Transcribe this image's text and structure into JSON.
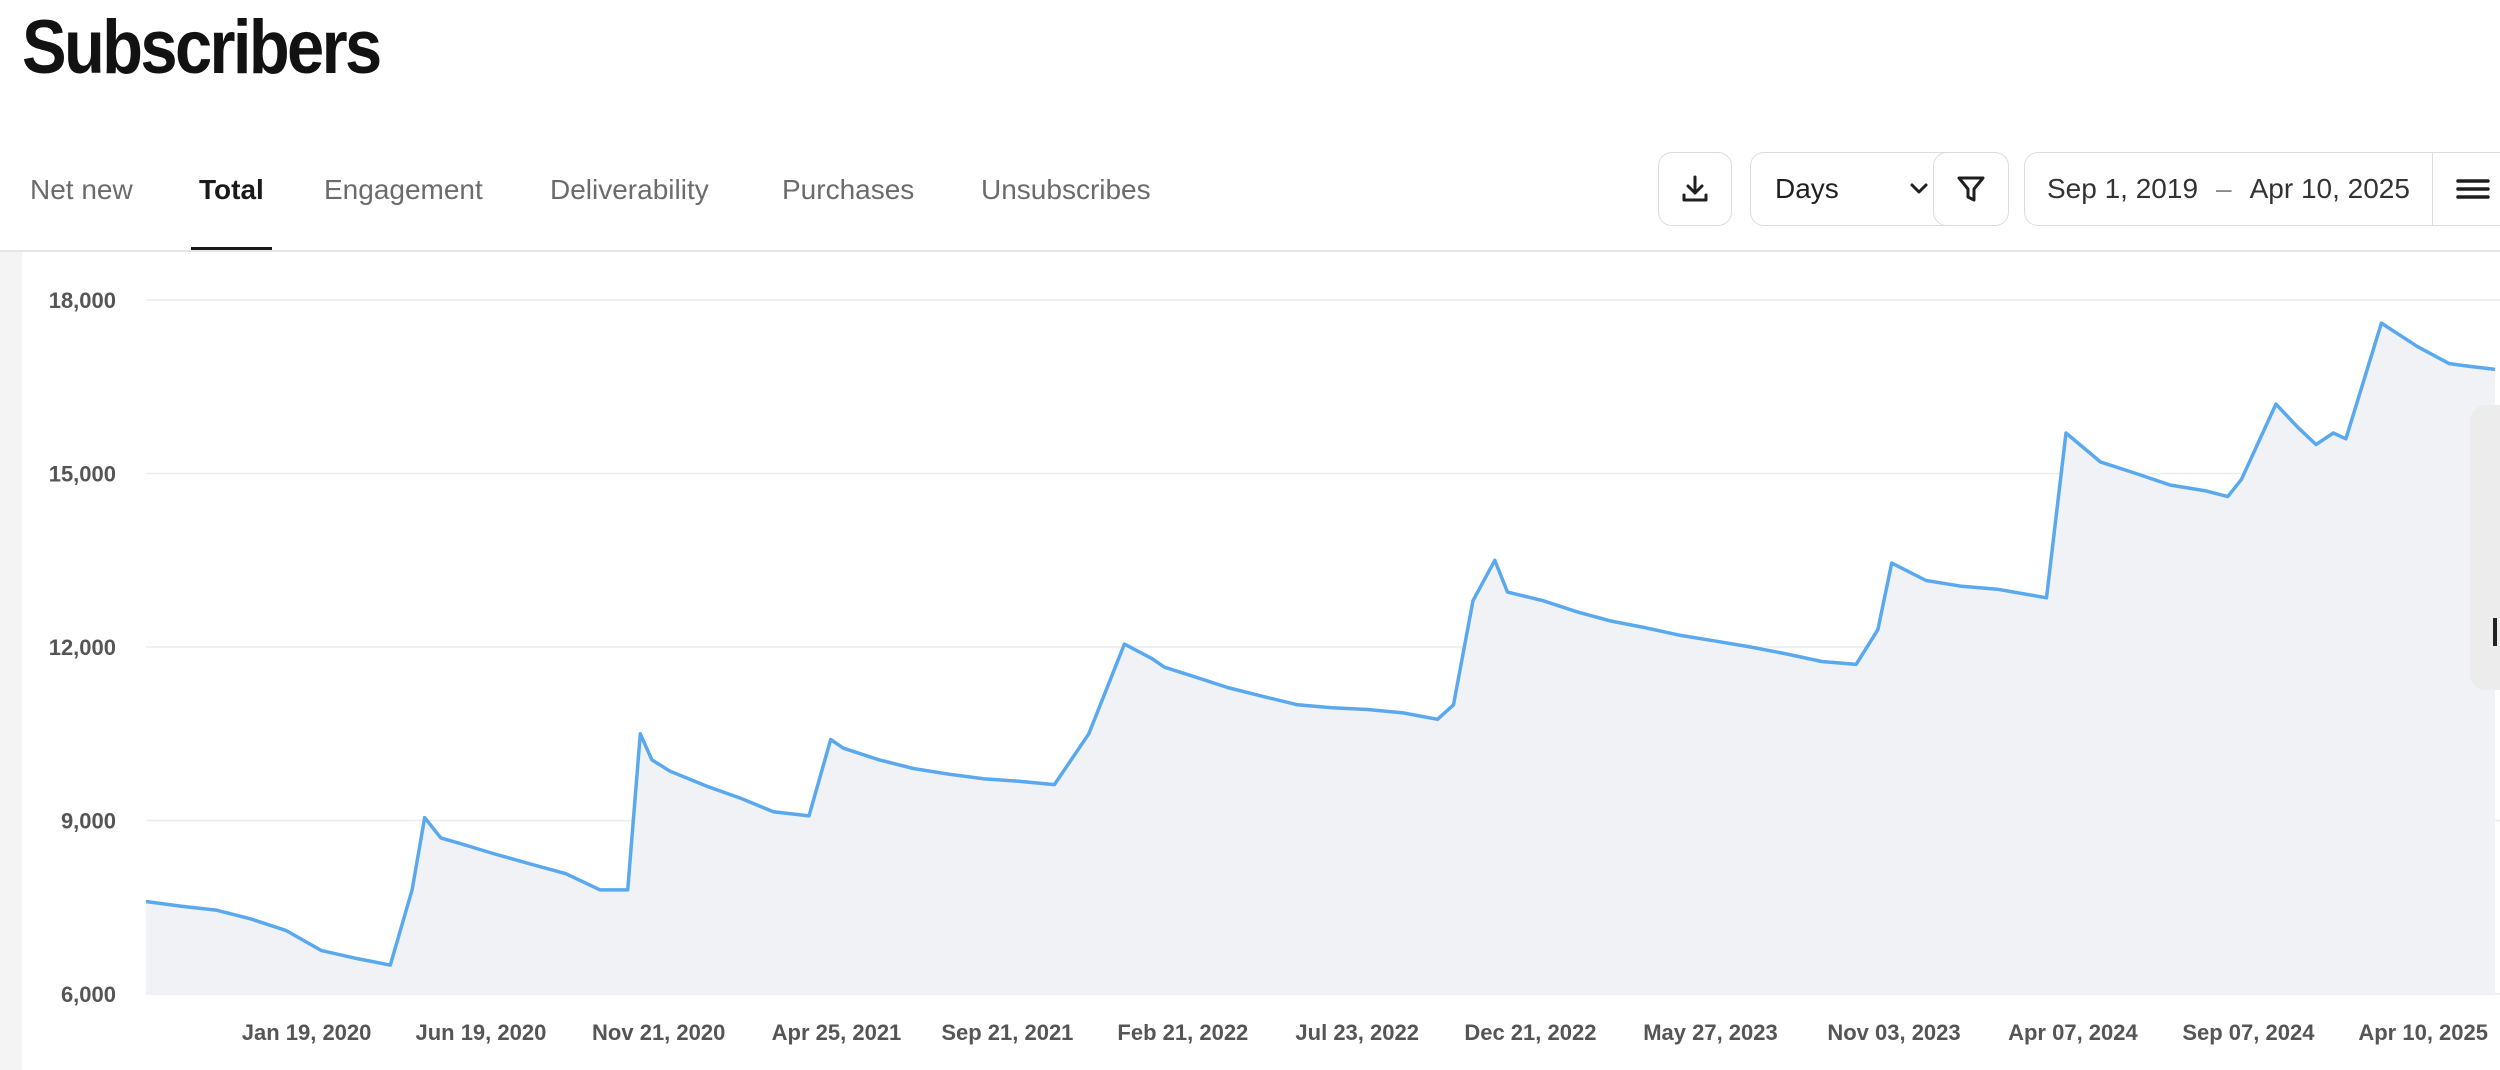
{
  "page": {
    "title": "Subscribers"
  },
  "tabs": [
    {
      "label": "Net new",
      "active": false
    },
    {
      "label": "Total",
      "active": true
    },
    {
      "label": "Engagement",
      "active": false
    },
    {
      "label": "Deliverability",
      "active": false
    },
    {
      "label": "Purchases",
      "active": false
    },
    {
      "label": "Unsubscribes",
      "active": false
    }
  ],
  "toolbar": {
    "download_icon": "download-icon",
    "granularity": "Days",
    "filter_icon": "filter-icon",
    "date_start": "Sep 1, 2019",
    "date_separator": "–",
    "date_end": "Apr 10, 2025",
    "menu_icon": "hamburger-menu-icon"
  },
  "colors": {
    "line": "#5aa9ee",
    "area": "#f1f2f6",
    "grid": "#ececec"
  },
  "chart_data": {
    "type": "area",
    "title": "",
    "xlabel": "",
    "ylabel": "",
    "ylim": [
      6000,
      18000
    ],
    "y_ticks": [
      "6,000",
      "9,000",
      "12,000",
      "15,000",
      "18,000"
    ],
    "y_tick_values": [
      6000,
      9000,
      12000,
      15000,
      18000
    ],
    "x_ticks": [
      "Jan 19, 2020",
      "Jun 19, 2020",
      "Nov 21, 2020",
      "Apr 25, 2021",
      "Sep 21, 2021",
      "Feb 21, 2022",
      "Jul 23, 2022",
      "Dec 21, 2022",
      "May 27, 2023",
      "Nov 03, 2023",
      "Apr 07, 2024",
      "Sep 07, 2024",
      "Apr 10, 2025"
    ],
    "x_tick_dates": [
      "2020-01-19",
      "2020-06-19",
      "2020-11-21",
      "2021-04-25",
      "2021-09-21",
      "2022-02-21",
      "2022-07-23",
      "2022-12-21",
      "2023-05-27",
      "2023-11-03",
      "2024-04-07",
      "2024-09-07",
      "2025-04-10"
    ],
    "grid": true,
    "series": [
      {
        "x": [
          "2019-09-01",
          "2019-10-01",
          "2019-11-01",
          "2019-12-01",
          "2020-01-01",
          "2020-02-01",
          "2020-03-01",
          "2020-04-01",
          "2020-04-20",
          "2020-05-01",
          "2020-05-15",
          "2020-06-01",
          "2020-07-01",
          "2020-08-01",
          "2020-09-01",
          "2020-10-01",
          "2020-10-25",
          "2020-11-05",
          "2020-11-15",
          "2020-12-01",
          "2021-01-01",
          "2021-02-01",
          "2021-03-01",
          "2021-04-01",
          "2021-04-20",
          "2021-05-01",
          "2021-06-01",
          "2021-07-01",
          "2021-08-01",
          "2021-09-01",
          "2021-10-01",
          "2021-11-01",
          "2021-12-01",
          "2022-01-01",
          "2022-01-25",
          "2022-02-05",
          "2022-03-01",
          "2022-04-01",
          "2022-05-01",
          "2022-06-01",
          "2022-07-01",
          "2022-08-01",
          "2022-09-01",
          "2022-10-01",
          "2022-10-15",
          "2022-11-01",
          "2022-11-20",
          "2022-12-01",
          "2023-01-01",
          "2023-02-01",
          "2023-03-01",
          "2023-04-01",
          "2023-05-01",
          "2023-06-01",
          "2023-07-01",
          "2023-08-01",
          "2023-09-01",
          "2023-10-01",
          "2023-10-20",
          "2023-11-01",
          "2023-12-01",
          "2024-01-01",
          "2024-02-01",
          "2024-03-01",
          "2024-03-15",
          "2024-04-01",
          "2024-05-01",
          "2024-06-01",
          "2024-07-01",
          "2024-08-01",
          "2024-08-20",
          "2024-09-01",
          "2024-10-01",
          "2024-10-20",
          "2024-11-05",
          "2024-11-20",
          "2024-12-01",
          "2025-01-01",
          "2025-02-01",
          "2025-03-01",
          "2025-03-20",
          "2025-04-10"
        ],
        "values": [
          7600,
          7520,
          7450,
          7300,
          7100,
          6750,
          6620,
          6500,
          7800,
          9050,
          8700,
          8600,
          8420,
          8250,
          8080,
          7800,
          7800,
          10500,
          10050,
          9850,
          9600,
          9380,
          9150,
          9080,
          10400,
          10250,
          10050,
          9900,
          9800,
          9720,
          9680,
          9620,
          10500,
          12050,
          11800,
          11650,
          11500,
          11300,
          11150,
          11000,
          10950,
          10920,
          10860,
          10750,
          11000,
          12800,
          13500,
          12950,
          12800,
          12600,
          12450,
          12330,
          12200,
          12100,
          12000,
          11880,
          11750,
          11700,
          12300,
          13450,
          13150,
          13050,
          13000,
          12900,
          12850,
          15700,
          15200,
          15000,
          14800,
          14700,
          14600,
          14900,
          16200,
          15800,
          15500,
          15700,
          15600,
          17600,
          17200,
          16900,
          16850,
          16800
        ]
      }
    ]
  }
}
